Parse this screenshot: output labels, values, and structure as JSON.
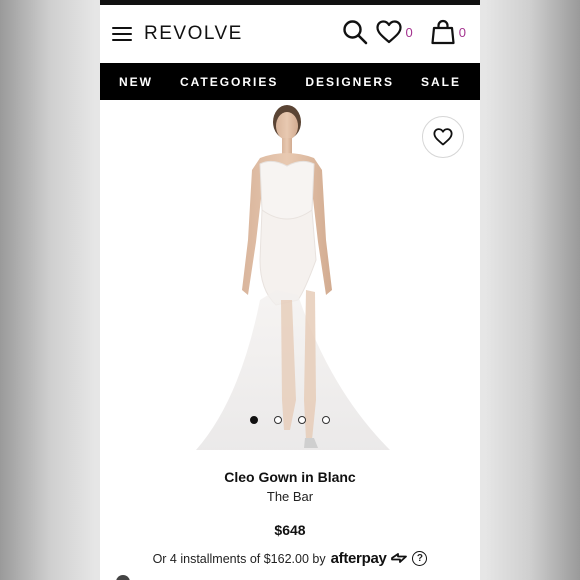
{
  "header": {
    "logo": "REVOLVE",
    "wishlist_count": "0",
    "cart_count": "0"
  },
  "nav": {
    "items": [
      "NEW",
      "CATEGORIES",
      "DESIGNERS",
      "SALE"
    ]
  },
  "product": {
    "name": "Cleo Gown in Blanc",
    "brand": "The Bar",
    "price": "$648",
    "installments_text": "Or 4 installments of $162.00 by",
    "afterpay_label": "afterpay",
    "help_label": "?",
    "gallery_count": 4,
    "gallery_active_index": 0
  },
  "colors": {
    "accent": "#a4338f",
    "nav_bg": "#000000"
  }
}
